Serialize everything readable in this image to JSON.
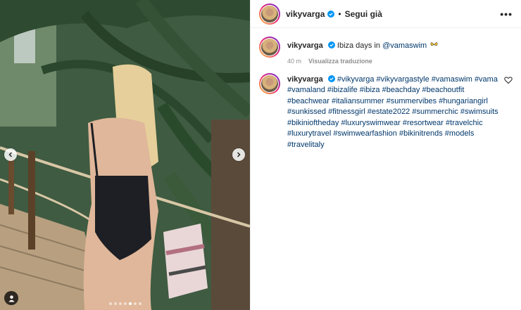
{
  "media": {
    "carousel_dots": 7,
    "active_dot": 4,
    "prev_icon": "chevron-left-icon",
    "next_icon": "chevron-right-icon",
    "tag_icon": "user-tag-icon"
  },
  "header": {
    "username": "vikyvarga",
    "separator": "•",
    "follow_label": "Segui già",
    "more_label": "•••"
  },
  "caption": {
    "username": "vikyvarga",
    "text_prefix": "Ibiza days in ",
    "mention": "@vamaswim",
    "emoji": "butterfly-emoji",
    "time": "40 m",
    "translate_label": "Visualizza traduzione"
  },
  "comment": {
    "username": "vikyvarga",
    "hashtags": [
      "#vikyvarga",
      "#vikyvargastyle",
      "#vamaswim",
      "#vama",
      "#vamaland",
      "#ibizalife",
      "#ibiza",
      "#beachday",
      "#beachoutfit",
      "#beachwear",
      "#italiansummer",
      "#summervibes",
      "#hungariangirl",
      "#sunkissed",
      "#fitnessgirl",
      "#estate2022",
      "#summerchic",
      "#swimsuits",
      "#bikinioftheday",
      "#luxuryswimwear",
      "#resortwear",
      "#travelchic",
      "#luxurytravel",
      "#swimwearfashion",
      "#bikinitrends",
      "#models",
      "#travelitaly"
    ],
    "like_icon": "heart-icon"
  },
  "colors": {
    "link": "#00376b",
    "verified": "#0095f6",
    "muted": "#8e8e8e"
  }
}
